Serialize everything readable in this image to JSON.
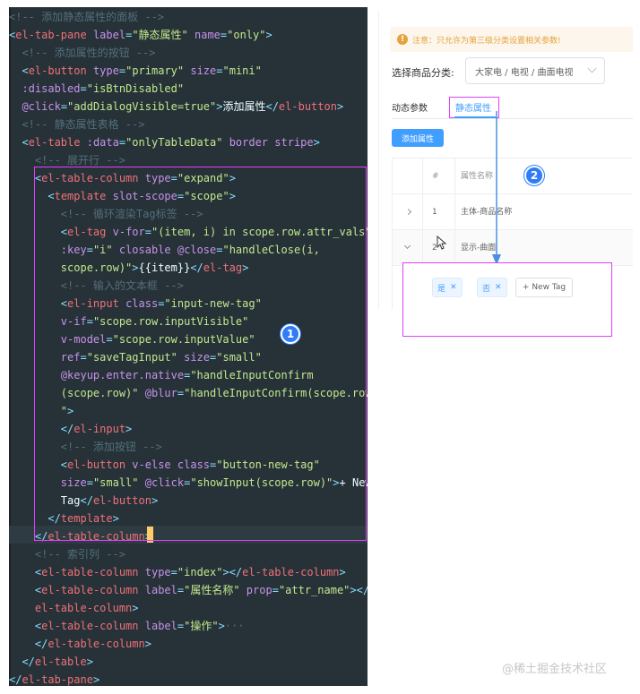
{
  "editor": {
    "lines": [
      [
        [
          "t-comment",
          "<!-- 添加静态属性的面板 -->"
        ]
      ],
      [
        [
          "t-punc",
          "<"
        ],
        [
          "t-tag",
          "el-tab-pane"
        ],
        [
          "t-plain",
          " "
        ],
        [
          "t-attr",
          "label"
        ],
        [
          "t-punc",
          "="
        ],
        [
          "t-str",
          "\"静态属性\""
        ],
        [
          "t-plain",
          " "
        ],
        [
          "t-attr",
          "name"
        ],
        [
          "t-punc",
          "="
        ],
        [
          "t-str",
          "\"only\""
        ],
        [
          "t-punc",
          ">"
        ]
      ],
      [
        [
          "t-plain",
          "  "
        ],
        [
          "t-comment",
          "<!-- 添加属性的按钮 -->"
        ]
      ],
      [
        [
          "t-plain",
          "  "
        ],
        [
          "t-punc",
          "<"
        ],
        [
          "t-tag",
          "el-button"
        ],
        [
          "t-plain",
          " "
        ],
        [
          "t-attr",
          "type"
        ],
        [
          "t-punc",
          "="
        ],
        [
          "t-str",
          "\"primary\""
        ],
        [
          "t-plain",
          " "
        ],
        [
          "t-attr",
          "size"
        ],
        [
          "t-punc",
          "="
        ],
        [
          "t-str",
          "\"mini\""
        ]
      ],
      [
        [
          "t-plain",
          "  "
        ],
        [
          "t-attr",
          ":disabled"
        ],
        [
          "t-punc",
          "="
        ],
        [
          "t-str",
          "\"isBtnDisabled\""
        ]
      ],
      [
        [
          "t-plain",
          "  "
        ],
        [
          "t-attr",
          "@click"
        ],
        [
          "t-punc",
          "="
        ],
        [
          "t-str",
          "\"addDialogVisible=true\""
        ],
        [
          "t-punc",
          ">"
        ],
        [
          "t-text",
          "添加属性"
        ],
        [
          "t-punc",
          "</"
        ],
        [
          "t-tag",
          "el-button"
        ],
        [
          "t-punc",
          ">"
        ]
      ],
      [
        [
          "t-plain",
          "  "
        ],
        [
          "t-comment",
          "<!-- 静态属性表格 -->"
        ]
      ],
      [
        [
          "t-plain",
          "  "
        ],
        [
          "t-punc",
          "<"
        ],
        [
          "t-tag",
          "el-table"
        ],
        [
          "t-plain",
          " "
        ],
        [
          "t-attr",
          ":data"
        ],
        [
          "t-punc",
          "="
        ],
        [
          "t-str",
          "\"onlyTableData\""
        ],
        [
          "t-plain",
          " "
        ],
        [
          "t-attr",
          "border"
        ],
        [
          "t-plain",
          " "
        ],
        [
          "t-attr",
          "stripe"
        ],
        [
          "t-punc",
          ">"
        ]
      ],
      [
        [
          "t-plain",
          "    "
        ],
        [
          "t-comment",
          "<!-- 展开行 -->"
        ]
      ],
      [
        [
          "t-plain",
          "    "
        ],
        [
          "t-punc",
          "<"
        ],
        [
          "t-tag",
          "el-table-column"
        ],
        [
          "t-plain",
          " "
        ],
        [
          "t-attr",
          "type"
        ],
        [
          "t-punc",
          "="
        ],
        [
          "t-str",
          "\"expand\""
        ],
        [
          "t-punc",
          ">"
        ]
      ],
      [
        [
          "t-plain",
          "      "
        ],
        [
          "t-punc",
          "<"
        ],
        [
          "t-tag",
          "template"
        ],
        [
          "t-plain",
          " "
        ],
        [
          "t-attr",
          "slot-scope"
        ],
        [
          "t-punc",
          "="
        ],
        [
          "t-str",
          "\"scope\""
        ],
        [
          "t-punc",
          ">"
        ]
      ],
      [
        [
          "t-plain",
          "        "
        ],
        [
          "t-comment",
          "<!-- 循环渲染Tag标签 -->"
        ]
      ],
      [
        [
          "t-plain",
          "        "
        ],
        [
          "t-punc",
          "<"
        ],
        [
          "t-tag",
          "el-tag"
        ],
        [
          "t-plain",
          " "
        ],
        [
          "t-attr",
          "v-for"
        ],
        [
          "t-punc",
          "="
        ],
        [
          "t-str",
          "\"(item, i) in scope.row.attr_vals\""
        ]
      ],
      [
        [
          "t-plain",
          "        "
        ],
        [
          "t-attr",
          ":key"
        ],
        [
          "t-punc",
          "="
        ],
        [
          "t-str",
          "\"i\""
        ],
        [
          "t-plain",
          " "
        ],
        [
          "t-attr",
          "closable"
        ],
        [
          "t-plain",
          " "
        ],
        [
          "t-attr",
          "@close"
        ],
        [
          "t-punc",
          "="
        ],
        [
          "t-str",
          "\"handleClose(i,"
        ]
      ],
      [
        [
          "t-plain",
          "        "
        ],
        [
          "t-str",
          "scope.row)\""
        ],
        [
          "t-punc",
          ">"
        ],
        [
          "t-text",
          "{{item}}"
        ],
        [
          "t-punc",
          "</"
        ],
        [
          "t-tag",
          "el-tag"
        ],
        [
          "t-punc",
          ">"
        ]
      ],
      [
        [
          "t-plain",
          "        "
        ],
        [
          "t-comment",
          "<!-- 输入的文本框 -->"
        ]
      ],
      [
        [
          "t-plain",
          "        "
        ],
        [
          "t-punc",
          "<"
        ],
        [
          "t-tag",
          "el-input"
        ],
        [
          "t-plain",
          " "
        ],
        [
          "t-attr",
          "class"
        ],
        [
          "t-punc",
          "="
        ],
        [
          "t-str",
          "\"input-new-tag\""
        ]
      ],
      [
        [
          "t-plain",
          "        "
        ],
        [
          "t-attr",
          "v-if"
        ],
        [
          "t-punc",
          "="
        ],
        [
          "t-str",
          "\"scope.row.inputVisible\""
        ]
      ],
      [
        [
          "t-plain",
          "        "
        ],
        [
          "t-attr",
          "v-model"
        ],
        [
          "t-punc",
          "="
        ],
        [
          "t-str",
          "\"scope.row.inputValue\""
        ]
      ],
      [
        [
          "t-plain",
          "        "
        ],
        [
          "t-attr",
          "ref"
        ],
        [
          "t-punc",
          "="
        ],
        [
          "t-str",
          "\"saveTagInput\""
        ],
        [
          "t-plain",
          " "
        ],
        [
          "t-attr",
          "size"
        ],
        [
          "t-punc",
          "="
        ],
        [
          "t-str",
          "\"small\""
        ]
      ],
      [
        [
          "t-plain",
          "        "
        ],
        [
          "t-attr",
          "@keyup.enter.native"
        ],
        [
          "t-punc",
          "="
        ],
        [
          "t-str",
          "\"handleInputConfirm"
        ]
      ],
      [
        [
          "t-plain",
          "        "
        ],
        [
          "t-str",
          "(scope.row)\""
        ],
        [
          "t-plain",
          " "
        ],
        [
          "t-attr",
          "@blur"
        ],
        [
          "t-punc",
          "="
        ],
        [
          "t-str",
          "\"handleInputConfirm(scope.row)"
        ]
      ],
      [
        [
          "t-plain",
          "        "
        ],
        [
          "t-str",
          "\""
        ],
        [
          "t-punc",
          ">"
        ]
      ],
      [
        [
          "t-plain",
          "        "
        ],
        [
          "t-punc",
          "</"
        ],
        [
          "t-tag",
          "el-input"
        ],
        [
          "t-punc",
          ">"
        ]
      ],
      [
        [
          "t-plain",
          "        "
        ],
        [
          "t-comment",
          "<!-- 添加按钮 -->"
        ]
      ],
      [
        [
          "t-plain",
          "        "
        ],
        [
          "t-punc",
          "<"
        ],
        [
          "t-tag",
          "el-button"
        ],
        [
          "t-plain",
          " "
        ],
        [
          "t-attr",
          "v-else"
        ],
        [
          "t-plain",
          " "
        ],
        [
          "t-attr",
          "class"
        ],
        [
          "t-punc",
          "="
        ],
        [
          "t-str",
          "\"button-new-tag\""
        ]
      ],
      [
        [
          "t-plain",
          "        "
        ],
        [
          "t-attr",
          "size"
        ],
        [
          "t-punc",
          "="
        ],
        [
          "t-str",
          "\"small\""
        ],
        [
          "t-plain",
          " "
        ],
        [
          "t-attr",
          "@click"
        ],
        [
          "t-punc",
          "="
        ],
        [
          "t-str",
          "\"showInput(scope.row)\""
        ],
        [
          "t-punc",
          ">"
        ],
        [
          "t-text",
          "+ New"
        ]
      ],
      [
        [
          "t-plain",
          "        "
        ],
        [
          "t-text",
          "Tag"
        ],
        [
          "t-punc",
          "</"
        ],
        [
          "t-tag",
          "el-button"
        ],
        [
          "t-punc",
          ">"
        ]
      ],
      [
        [
          "t-plain",
          "      "
        ],
        [
          "t-punc",
          "</"
        ],
        [
          "t-tag",
          "template"
        ],
        [
          "t-punc",
          ">"
        ]
      ],
      [
        [
          "t-plain",
          "    "
        ],
        [
          "t-punc",
          "</"
        ],
        [
          "t-tag",
          "el-table-column"
        ],
        [
          "t-punc",
          ">"
        ]
      ],
      [
        [
          "t-plain",
          "    "
        ],
        [
          "t-comment",
          "<!-- 索引列 -->"
        ]
      ],
      [
        [
          "t-plain",
          "    "
        ],
        [
          "t-punc",
          "<"
        ],
        [
          "t-tag",
          "el-table-column"
        ],
        [
          "t-plain",
          " "
        ],
        [
          "t-attr",
          "type"
        ],
        [
          "t-punc",
          "="
        ],
        [
          "t-str",
          "\"index\""
        ],
        [
          "t-punc",
          "></"
        ],
        [
          "t-tag",
          "el-table-column"
        ],
        [
          "t-punc",
          ">"
        ]
      ],
      [
        [
          "t-plain",
          "    "
        ],
        [
          "t-punc",
          "<"
        ],
        [
          "t-tag",
          "el-table-column"
        ],
        [
          "t-plain",
          " "
        ],
        [
          "t-attr",
          "label"
        ],
        [
          "t-punc",
          "="
        ],
        [
          "t-str",
          "\"属性名称\""
        ],
        [
          "t-plain",
          " "
        ],
        [
          "t-attr",
          "prop"
        ],
        [
          "t-punc",
          "="
        ],
        [
          "t-str",
          "\"attr_name\""
        ],
        [
          "t-punc",
          "></"
        ]
      ],
      [
        [
          "t-plain",
          "    "
        ],
        [
          "t-tag",
          "el-table-column"
        ],
        [
          "t-punc",
          ">"
        ]
      ],
      [
        [
          "t-plain",
          "    "
        ],
        [
          "t-punc",
          "<"
        ],
        [
          "t-tag",
          "el-table-column"
        ],
        [
          "t-plain",
          " "
        ],
        [
          "t-attr",
          "label"
        ],
        [
          "t-punc",
          "="
        ],
        [
          "t-str",
          "\"操作\""
        ],
        [
          "t-punc",
          ">"
        ],
        [
          "t-comment",
          "···"
        ]
      ],
      [
        [
          "t-plain",
          "    "
        ],
        [
          "t-punc",
          "</"
        ],
        [
          "t-tag",
          "el-table-column"
        ],
        [
          "t-punc",
          ">"
        ]
      ],
      [
        [
          "t-plain",
          "  "
        ],
        [
          "t-punc",
          "</"
        ],
        [
          "t-tag",
          "el-table"
        ],
        [
          "t-punc",
          ">"
        ]
      ],
      [
        [
          "t-punc",
          "</"
        ],
        [
          "t-tag",
          "el-tab-pane"
        ],
        [
          "t-punc",
          ">"
        ]
      ]
    ]
  },
  "badges": {
    "one": "1",
    "two": "2"
  },
  "ui": {
    "alert": "注意：只允许为第三级分类设置相关参数!",
    "category_label": "选择商品分类:",
    "category_value": "大家电 / 电视 / 曲面电视",
    "tabs": {
      "dynamic": "动态参数",
      "static": "静态属性"
    },
    "add_button": "添加属性",
    "table": {
      "headers": {
        "index": "#",
        "name": "属性名称"
      },
      "rows": [
        {
          "index": "1",
          "name": "主体-商品名称"
        },
        {
          "index": "2",
          "name": "显示-曲面"
        }
      ]
    },
    "tags": [
      "是",
      "否"
    ],
    "new_tag": "+ New Tag"
  },
  "watermark": "@稀土掘金技术社区",
  "colors": {
    "accent": "#409eff",
    "highlight": "#e040fb",
    "editor_bg": "#263238"
  }
}
